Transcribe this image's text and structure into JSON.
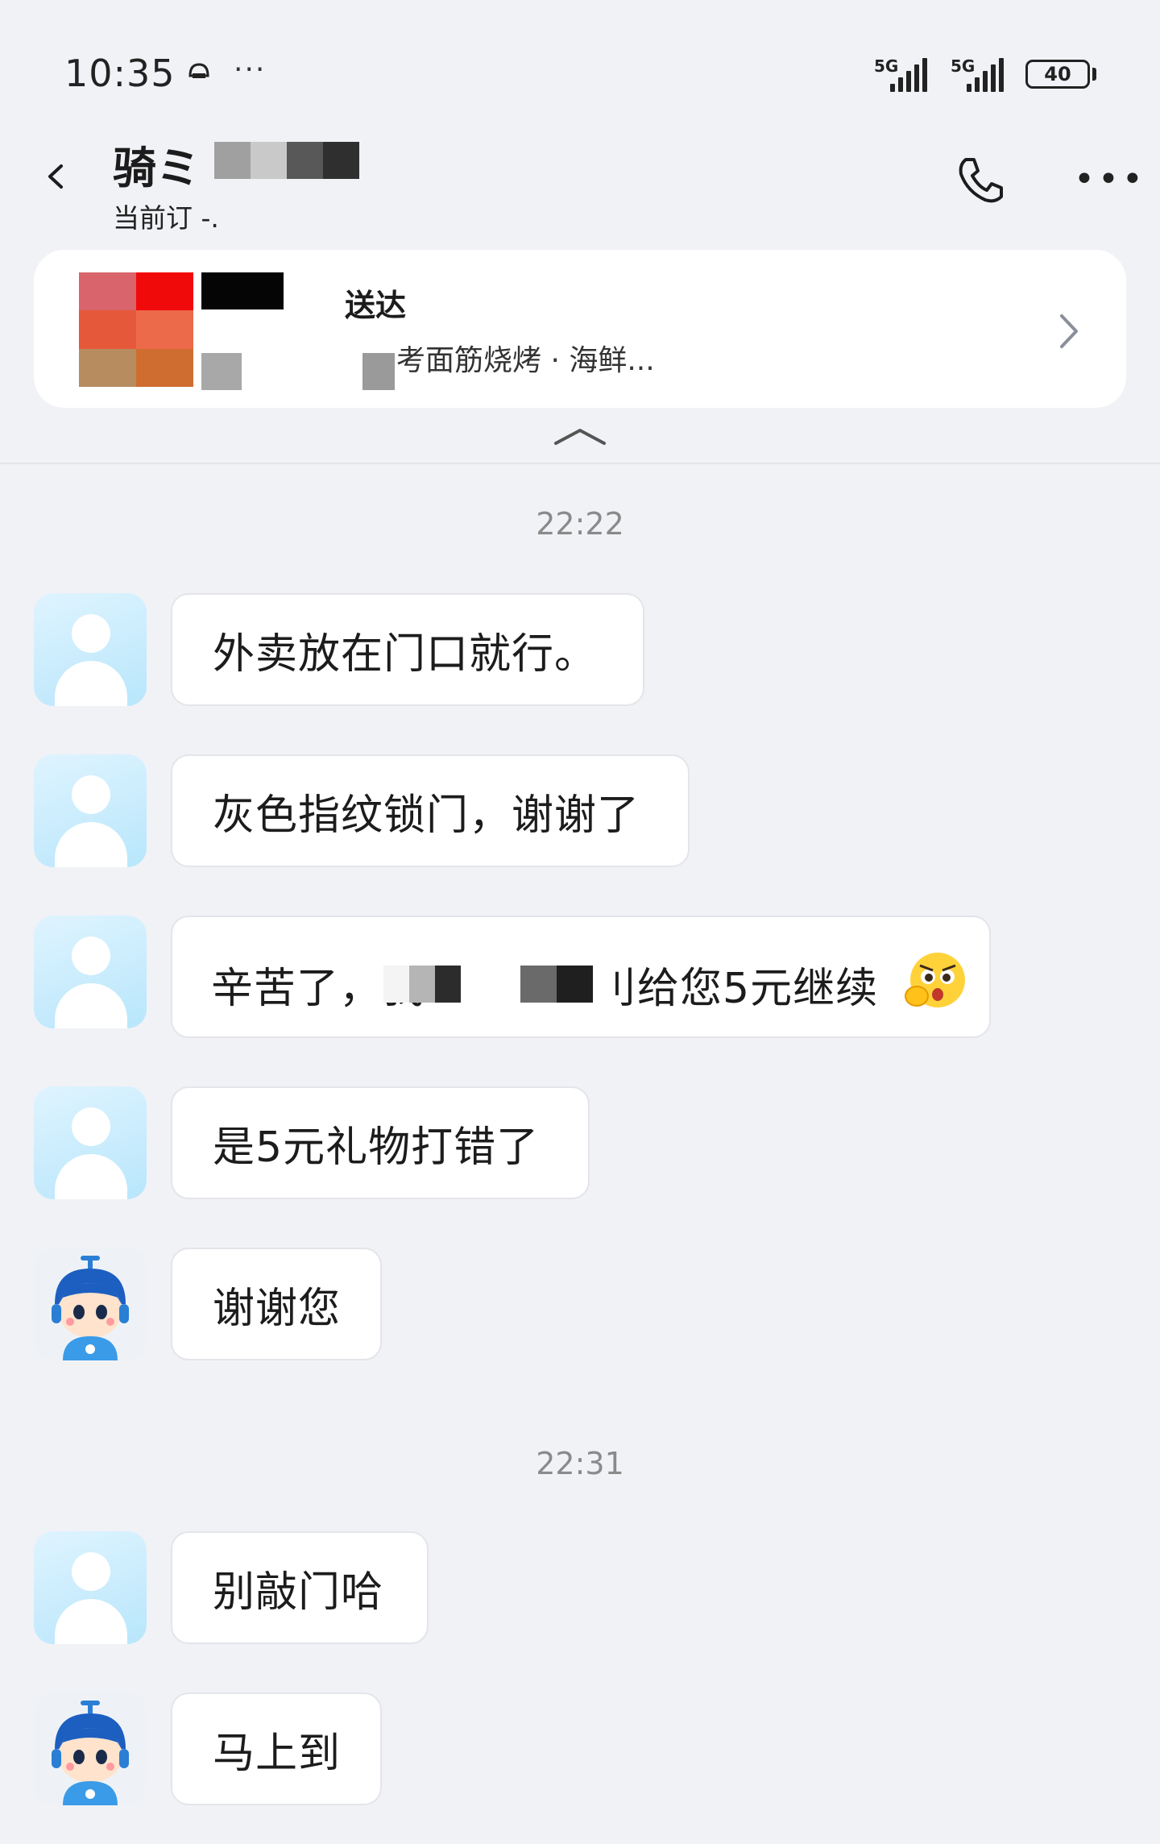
{
  "status_bar": {
    "time": "10:35",
    "dots": "···",
    "signal1_label": "5G",
    "signal2_label": "5G",
    "battery": "40"
  },
  "header": {
    "rider_name": "骑ミ",
    "status": "当前订 -.",
    "icons": [
      "back-arrow-icon",
      "phone-icon",
      "more-icon"
    ]
  },
  "order_card": {
    "status": "送达",
    "shop": "考面筋烧烤 · 海鲜..."
  },
  "chat": {
    "time1": "22:22",
    "time2": "22:31",
    "messages": [
      {
        "sender": "user",
        "text": "外卖放在门口就行。"
      },
      {
        "sender": "user",
        "text": "灰色指纹锁门，谢谢了"
      },
      {
        "sender": "user",
        "text_part1": "辛苦了，我",
        "text_part2": "刂给您5元继续"
      },
      {
        "sender": "user",
        "text": "是5元礼物打错了"
      },
      {
        "sender": "rider",
        "text": "谢谢您"
      },
      {
        "sender": "user",
        "text": "别敲门哈"
      },
      {
        "sender": "rider",
        "text": "马上到"
      }
    ]
  },
  "colors": {
    "background": "#f1f2f6",
    "bubble": "#ffffff",
    "avatar_user": "#b8e6fb",
    "time_text": "#8a8a8a"
  }
}
